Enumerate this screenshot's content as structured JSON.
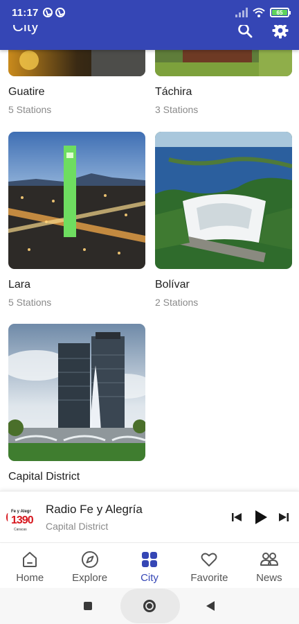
{
  "status_bar": {
    "time": "11:17",
    "battery": "65"
  },
  "app_bar": {
    "title": "City",
    "search_icon": "search-icon",
    "settings_icon": "settings-gear-icon"
  },
  "cities": [
    {
      "name": "Guatire",
      "count": "5 Stations"
    },
    {
      "name": "Táchira",
      "count": "3 Stations"
    },
    {
      "name": "Lara",
      "count": "5 Stations"
    },
    {
      "name": "Bolívar",
      "count": "2 Stations"
    },
    {
      "name": "Capital District",
      "count": ""
    }
  ],
  "now_playing": {
    "station": "Radio Fe y Alegría",
    "city": "Capital District",
    "logo": {
      "top": "Fe y Alegr",
      "number": "1390",
      "sub": "Caracas"
    }
  },
  "bottom_nav": {
    "items": [
      {
        "label": "Home",
        "icon": "home-icon"
      },
      {
        "label": "Explore",
        "icon": "compass-icon"
      },
      {
        "label": "City",
        "icon": "grid-icon"
      },
      {
        "label": "Favorite",
        "icon": "heart-icon"
      },
      {
        "label": "News",
        "icon": "people-icon"
      }
    ],
    "active": "City"
  },
  "colors": {
    "primary": "#3546b5",
    "text": "#1e1e1e",
    "muted": "#8a8a8a",
    "station_red": "#d6161d"
  }
}
